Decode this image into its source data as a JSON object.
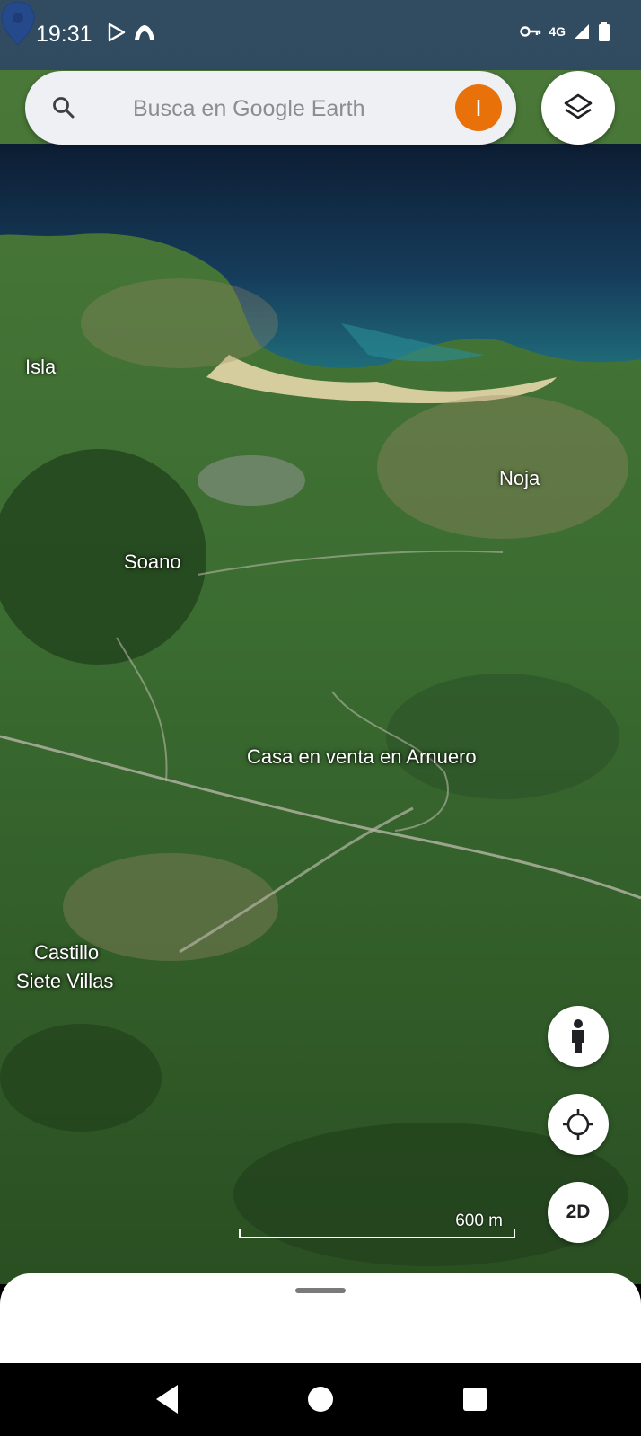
{
  "status_bar": {
    "time": "19:31",
    "network": "4G",
    "icons": [
      "play-store-icon",
      "mountain-app-icon",
      "vpn-key-icon",
      "signal-icon",
      "battery-icon"
    ]
  },
  "search": {
    "placeholder": "Busca en Google Earth",
    "avatar_letter": "I",
    "avatar_color": "#e8710a"
  },
  "map": {
    "places": {
      "isla": "Isla",
      "noja": "Noja",
      "soano": "Soano",
      "pin_label": "Casa en venta en Arnuero",
      "castillo_1": "Castillo",
      "castillo_2": "Siete Villas"
    },
    "scale": "600 m",
    "pin_color": "#1a73e8"
  },
  "controls": {
    "view_mode": "2D"
  }
}
